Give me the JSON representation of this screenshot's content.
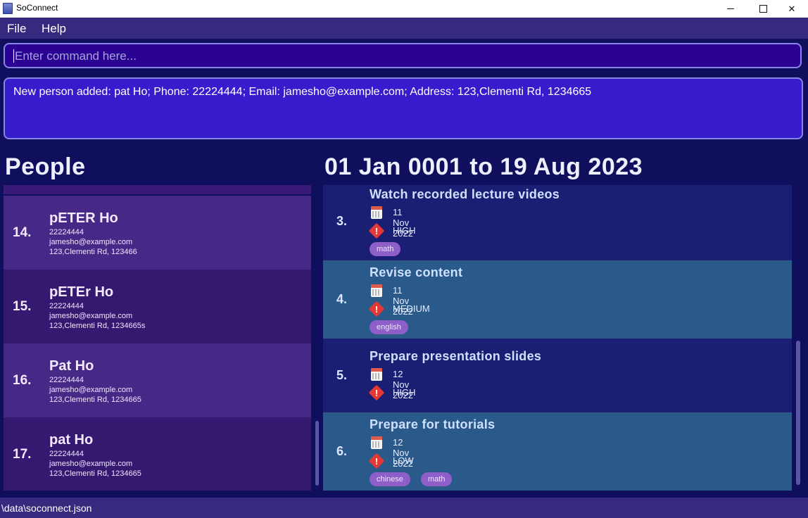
{
  "window": {
    "title": "SoConnect",
    "minimize_glyph": "—",
    "maximize_glyph": "☐",
    "close_glyph": "✕"
  },
  "menu": {
    "items": [
      "File",
      "Help"
    ]
  },
  "command": {
    "placeholder": "Enter command here...",
    "value": ""
  },
  "result": {
    "text": "New person added: pat Ho; Phone: 22224444; Email: jamesho@example.com; Address: 123,Clementi Rd, 1234665"
  },
  "people": {
    "heading": "People",
    "items": [
      {
        "index": "14.",
        "name": "pETER Ho",
        "phone": "22224444",
        "email": "jamesho@example.com",
        "address": "123,Clementi Rd, 123466"
      },
      {
        "index": "15.",
        "name": "pETEr Ho",
        "phone": "22224444",
        "email": "jamesho@example.com",
        "address": "123,Clementi Rd, 1234665s"
      },
      {
        "index": "16.",
        "name": "Pat Ho",
        "phone": "22224444",
        "email": "jamesho@example.com",
        "address": "123,Clementi Rd, 1234665"
      },
      {
        "index": "17.",
        "name": "pat Ho",
        "phone": "22224444",
        "email": "jamesho@example.com",
        "address": "123,Clementi Rd, 1234665"
      }
    ]
  },
  "tasks": {
    "heading": "01 Jan 0001 to 19 Aug 2023",
    "items": [
      {
        "index": "3.",
        "title": "Watch recorded lecture videos",
        "date": "11 Nov 2022",
        "priority": "HIGH",
        "tags": [
          "math"
        ]
      },
      {
        "index": "4.",
        "title": "Revise content",
        "date": "11 Nov 2022",
        "priority": "MEDIUM",
        "tags": [
          "english"
        ]
      },
      {
        "index": "5.",
        "title": "Prepare presentation slides",
        "date": "12 Nov 2022",
        "priority": "HIGH",
        "tags": []
      },
      {
        "index": "6.",
        "title": "Prepare for tutorials",
        "date": "12 Nov 2022",
        "priority": "LOW",
        "tags": [
          "chinese",
          "math"
        ]
      }
    ],
    "priority_mark": "!"
  },
  "status": {
    "path": "\\data\\soconnect.json"
  },
  "colors": {
    "background": "#0f0f5e",
    "menubar": "#362a7f",
    "command_bg": "#2a0394",
    "result_bg": "#371ccd",
    "priority": "#e53935",
    "tag": "#8e5fc8"
  }
}
